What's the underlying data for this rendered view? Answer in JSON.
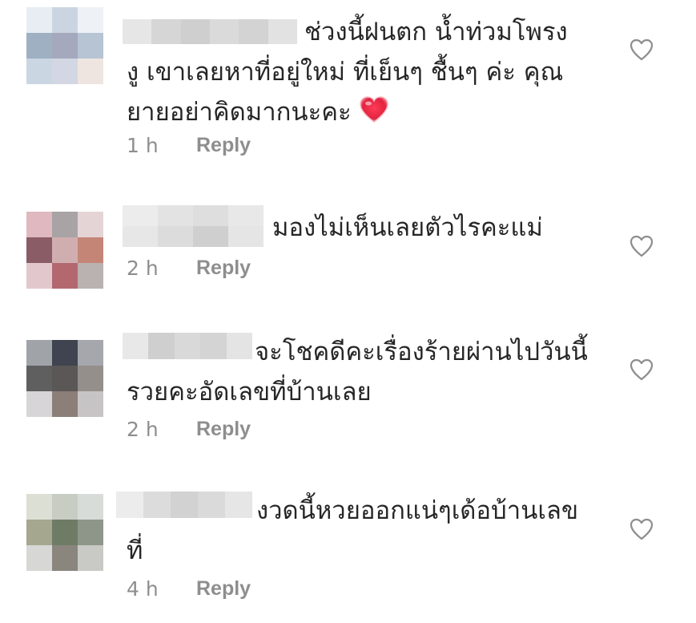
{
  "comments": [
    {
      "lines": [
        "ช่วงนี้ฝนตก น้ำท่วมโพรง",
        "งู เขาเลยหาที่อยู่ใหม่ ที่เย็นๆ ชื้นๆ ค่ะ คุณ",
        "ยายอย่าคิดมากนะคะ"
      ],
      "time": "1 h",
      "reply_label": "Reply",
      "has_heart_emoji": true,
      "avatar_colors": [
        "#e7edf3",
        "#cbd5e1",
        "#eef2f6",
        "#9fb0c3",
        "#a4a9bd",
        "#b6c4d4",
        "#cbd6e3",
        "#d3d7e3",
        "#efe5e0",
        "#ffffff",
        "#eceff5",
        "#ffffff"
      ]
    },
    {
      "lines": [
        "มองไม่เห็นเลยตัวไรคะแม่"
      ],
      "time": "2 h",
      "reply_label": "Reply",
      "has_heart_emoji": false,
      "avatar_colors": [
        "#e0b8bf",
        "#a8a4a6",
        "#e4d4d6",
        "#8a5d66",
        "#d0aeb0",
        "#c48576",
        "#e2c8cc",
        "#b36870",
        "#b9b2b1"
      ]
    },
    {
      "lines": [
        "จะโชคดีคะเรื่องร้ายผ่านไปวันนี้",
        "รวยคะอัดเลขที่บ้านเลย"
      ],
      "time": "2 h",
      "reply_label": "Reply",
      "has_heart_emoji": false,
      "avatar_colors": [
        "#a0a3a8",
        "#3f4450",
        "#a6a7ad",
        "#5f5f60",
        "#5a5756",
        "#958f8c",
        "#d7d5d7",
        "#8c7e79",
        "#c7c4c5"
      ]
    },
    {
      "lines": [
        "งวดนี้หวยออกแน่ๆเด้อบ้านเลข",
        "ที่"
      ],
      "time": "4 h",
      "reply_label": "Reply",
      "has_heart_emoji": false,
      "avatar_colors": [
        "#dcdfd4",
        "#c8cdc3",
        "#d8dcd8",
        "#a5a78f",
        "#6e7c66",
        "#8e9689",
        "#d7d8d5",
        "#8a867e",
        "#c9cac6"
      ]
    }
  ]
}
